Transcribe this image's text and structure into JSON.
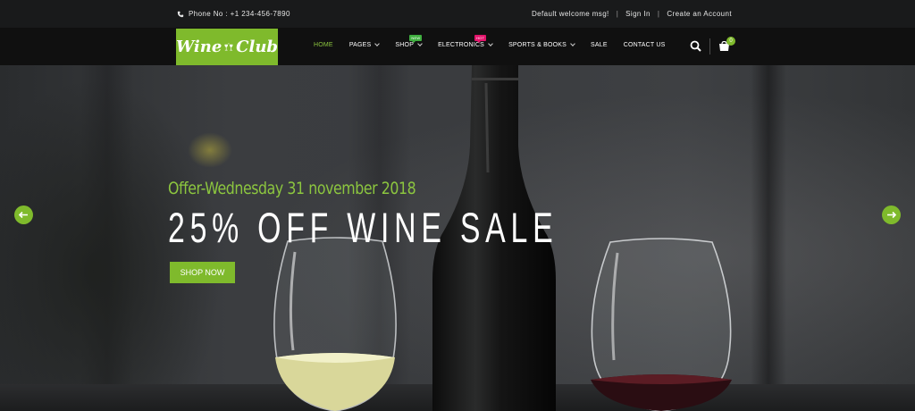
{
  "topbar": {
    "phone_label": "Phone No : +1 234-456-7890",
    "welcome": "Default welcome msg!",
    "sign_in": "Sign In",
    "create_account": "Create an Account",
    "separator": "|"
  },
  "logo": {
    "word1": "Wine",
    "word2": "Club"
  },
  "nav": {
    "items": [
      {
        "label": "HOME"
      },
      {
        "label": "PAGES"
      },
      {
        "label": "SHOP",
        "badge": "NEW"
      },
      {
        "label": "ELECTRONICS",
        "badge": "HOT"
      },
      {
        "label": "SPORTS & BOOKS"
      },
      {
        "label": "SALE"
      },
      {
        "label": "CONTACT US"
      }
    ]
  },
  "cart": {
    "count": "0"
  },
  "slide": {
    "offer": "Offer-Wednesday 31 november 2018",
    "headline": "25% OFF WINE SALE",
    "button": "SHOP NOW"
  },
  "colors": {
    "accent": "#7fba2c",
    "offer_text": "#8cc63f",
    "badge_new": "#3fae3f",
    "badge_hot": "#e2146b",
    "topbar_bg": "#191a1b",
    "navbar_bg": "#101010"
  },
  "icons": {
    "phone": "phone-icon",
    "search": "search-icon",
    "cart": "cart-icon",
    "prev": "arrow-left-icon",
    "next": "arrow-right-icon"
  }
}
